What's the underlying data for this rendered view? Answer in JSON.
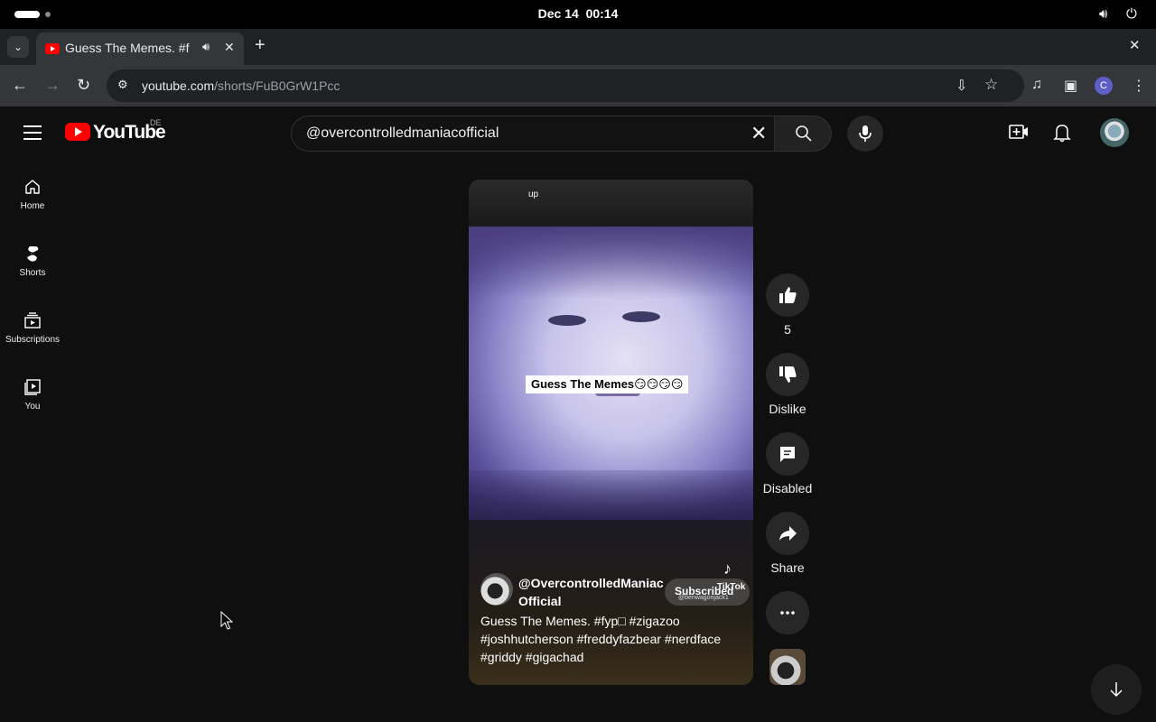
{
  "os": {
    "date": "Dec 14",
    "time": "00:14",
    "icons": [
      "volume-icon",
      "power-icon"
    ]
  },
  "browser": {
    "tab": {
      "title": "Guess The Memes. #f",
      "favicon": "youtube-favicon",
      "audio_icon": "speaker-icon"
    },
    "url_host": "youtube.com",
    "url_path": "/shorts/FuB0GrW1Pcc",
    "profile_initial": "C"
  },
  "youtube": {
    "logo_text": "YouTube",
    "country_code": "DE",
    "search_query": "@overcontrolledmaniacofficial",
    "accent_color": "#ff0000",
    "nav": [
      {
        "label": "Home",
        "icon": "home-icon"
      },
      {
        "label": "Shorts",
        "icon": "shorts-icon"
      },
      {
        "label": "Subscriptions",
        "icon": "subscriptions-icon"
      },
      {
        "label": "You",
        "icon": "you-icon"
      }
    ]
  },
  "short": {
    "overlay_top_text": "up",
    "caption": "Guess The Memes😏😏😏😏",
    "channel_name": "@OvercontrolledManiac Official",
    "subscribe_label": "Subscribed",
    "watermark": "TikTok",
    "watermark_user": "@benwagonjack1",
    "description": "Guess The Memes. #fyp□ #zigazoo #joshhutcherson #freddyfazbear #nerdface #griddy #gigachad",
    "actions": {
      "likes": "5",
      "dislike_label": "Dislike",
      "comments_label": "Disabled",
      "share_label": "Share"
    }
  }
}
